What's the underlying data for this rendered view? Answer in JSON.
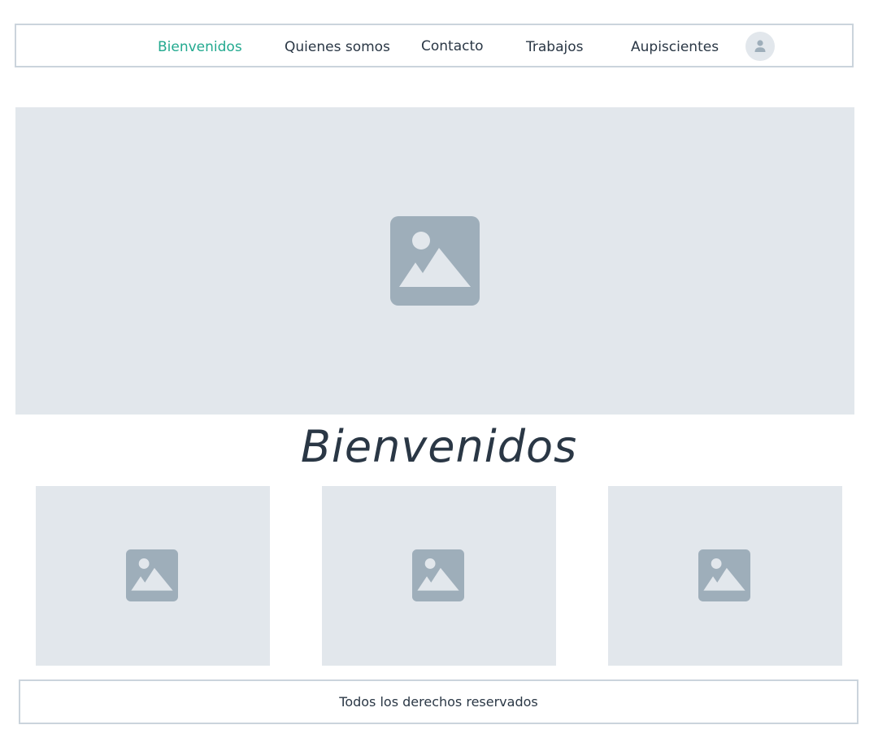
{
  "nav": {
    "items": [
      {
        "label": "Bienvenidos",
        "active": true
      },
      {
        "label": "Quienes somos",
        "active": false
      },
      {
        "label": "Contacto",
        "active": false
      },
      {
        "label": "Trabajos",
        "active": false
      },
      {
        "label": "Aupiscientes",
        "active": false
      }
    ],
    "avatar_icon": "user-icon"
  },
  "hero": {
    "icon": "image-placeholder-icon"
  },
  "main": {
    "title": "Bienvenidos"
  },
  "cards": [
    {
      "icon": "image-placeholder-icon"
    },
    {
      "icon": "image-placeholder-icon"
    },
    {
      "icon": "image-placeholder-icon"
    }
  ],
  "footer": {
    "text": "Todos los derechos reservados"
  },
  "colors": {
    "accent": "#22a98f",
    "text": "#2a3745",
    "placeholder_bg": "#e2e7ec",
    "placeholder_icon": "#9eaeba",
    "border": "#cbd4dc"
  }
}
